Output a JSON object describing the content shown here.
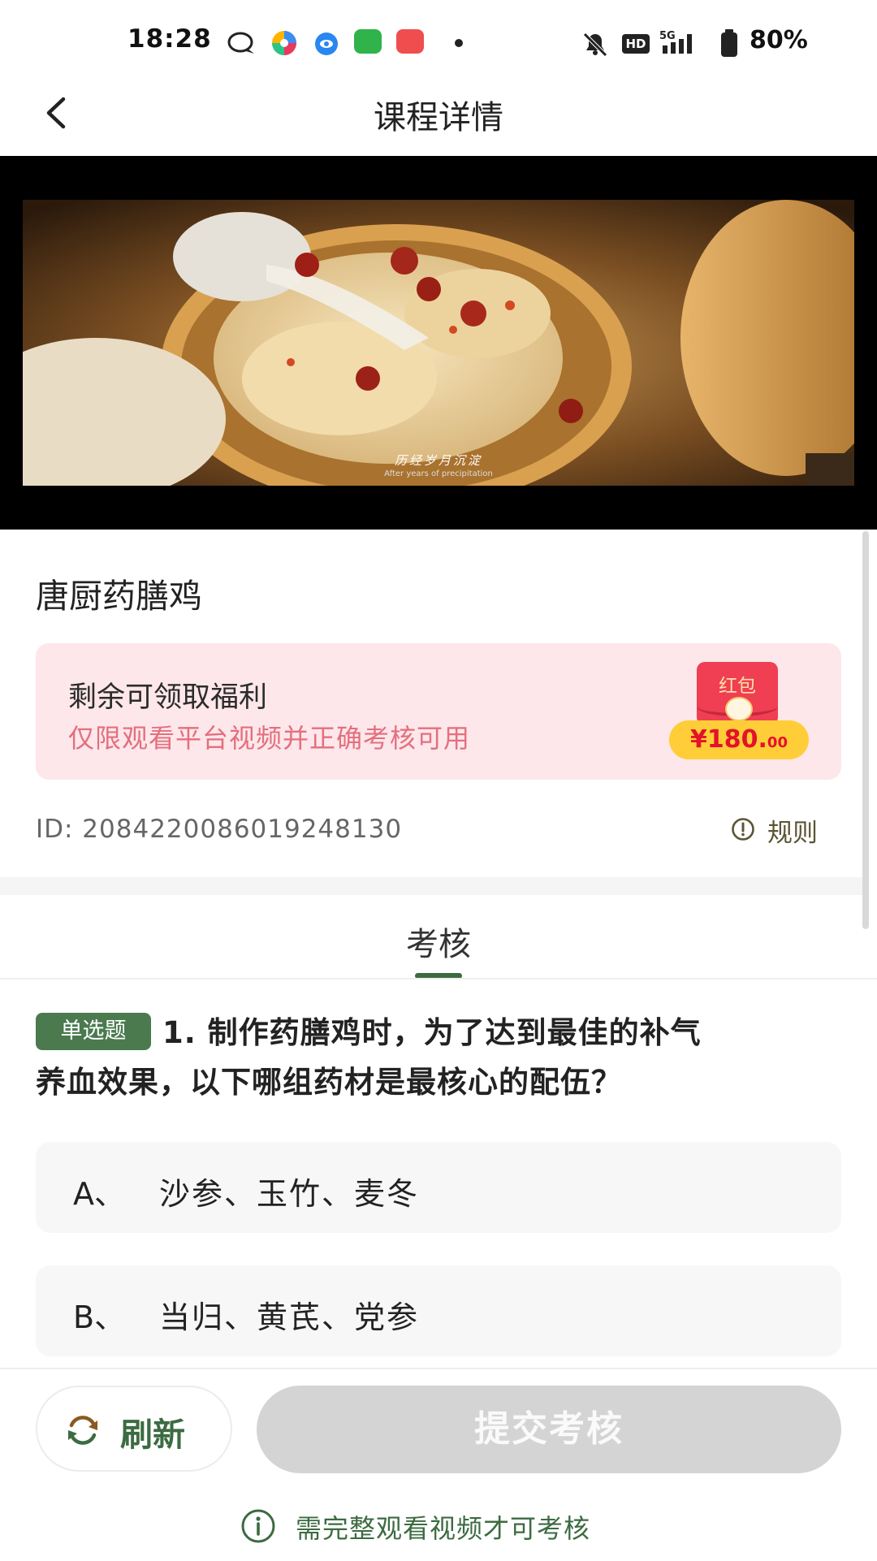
{
  "status_bar": {
    "time": "18:28",
    "battery": "80%",
    "app_icons": [
      "chat-bubble-icon",
      "colorful-pinwheel-icon",
      "blue-app-icon",
      "green-app-icon",
      "music-app-icon"
    ],
    "system_icons": [
      "mute-bell-icon",
      "hd-icon",
      "5g-signal-icon",
      "battery-icon"
    ]
  },
  "header": {
    "title": "课程详情",
    "back_icon": "chevron-left-icon"
  },
  "video": {
    "caption_zh": "历经岁月沉淀",
    "caption_en": "After years of precipitation"
  },
  "course": {
    "title": "唐厨药膳鸡",
    "id_text": "ID: 2084220086019248130",
    "rule_label": "规则"
  },
  "welfare": {
    "title": "剩余可领取福利",
    "subtitle": "仅限观看平台视频并正确考核可用",
    "envelope_label": "红包",
    "amount_main": "¥180.",
    "amount_decimal": "00"
  },
  "tab": {
    "label": "考核"
  },
  "question": {
    "badge": "单选题",
    "line1": "1. 制作药膳鸡时，为了达到最佳的补气",
    "line2": "养血效果，以下哪组药材是最核心的配伍？",
    "options": [
      {
        "letter": "A、",
        "text": "沙参、玉竹、麦冬"
      },
      {
        "letter": "B、",
        "text": "当归、黄芪、党参"
      }
    ]
  },
  "bottom": {
    "refresh_label": "刷新",
    "submit_label": "提交考核",
    "note": "需完整观看视频才可考核"
  },
  "colors": {
    "accent_green": "#3c6b41",
    "welfare_bg": "#fde7ea",
    "welfare_sub": "#e46f7e",
    "envelope_red": "#f03e52",
    "amount_yellow": "#ffcd38",
    "submit_disabled": "#d4d4d4"
  }
}
